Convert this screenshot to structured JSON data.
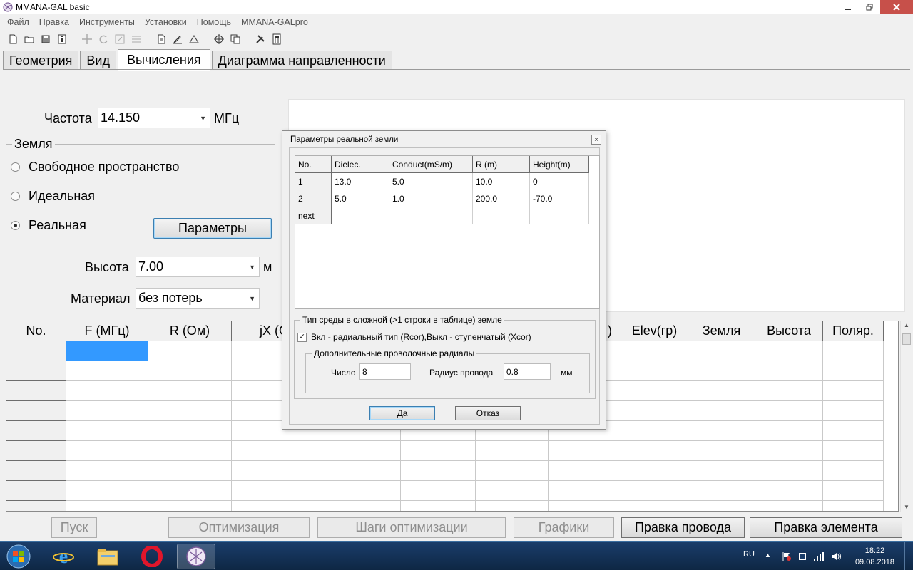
{
  "window": {
    "title": "MMANA-GAL basic"
  },
  "menu": [
    "Файл",
    "Правка",
    "Инструменты",
    "Установки",
    "Помощь",
    "MMANA-GALpro"
  ],
  "tabs": [
    "Геометрия",
    "Вид",
    "Вычисления",
    "Диаграмма направленности"
  ],
  "active_tab": "Вычисления",
  "calc": {
    "freq_label": "Частота",
    "freq_value": "14.150",
    "freq_unit": "МГц",
    "ground_legend": "Земля",
    "ground_options": [
      "Свободное пространство",
      "Идеальная",
      "Реальная"
    ],
    "ground_selected": "Реальная",
    "params_button": "Параметры",
    "height_label": "Высота",
    "height_value": "7.00",
    "height_unit": "м",
    "material_label": "Материал",
    "material_value": "без потерь"
  },
  "results_table": {
    "headers": [
      "No.",
      "F (МГц)",
      "R (Ом)",
      "jX (О",
      "",
      "",
      "",
      ")",
      "Elev(гр)",
      "Земля",
      "Высота",
      "Поляр."
    ]
  },
  "bottom_buttons": {
    "run": "Пуск",
    "optimize": "Оптимизация",
    "opt_steps": "Шаги оптимизации",
    "graphs": "Графики",
    "edit_wire": "Правка провода",
    "edit_element": "Правка элемента"
  },
  "dialog": {
    "title": "Параметры реальной земли",
    "close_glyph": "×",
    "table": {
      "headers": [
        "No.",
        "Dielec.",
        "Conduct(mS/m)",
        "R (m)",
        "Height(m)"
      ],
      "rows": [
        [
          "1",
          "13.0",
          "5.0",
          "10.0",
          "0"
        ],
        [
          "2",
          "5.0",
          "1.0",
          "200.0",
          "-70.0"
        ],
        [
          "next",
          "",
          "",
          "",
          ""
        ]
      ]
    },
    "medium_legend": "Тип среды в сложной (>1 строки в таблице) земле",
    "radial_checkbox_label": "Вкл - радиальный тип (Rcor),Выкл - ступенчатый (Xcor)",
    "radial_checked": true,
    "radials_legend": "Дополнительные проволочные радиалы",
    "count_label": "Число",
    "count_value": "8",
    "radius_label": "Радиус провода",
    "radius_value": "0.8",
    "radius_unit": "мм",
    "ok": "Да",
    "cancel": "Отказ"
  },
  "taskbar": {
    "lang": "RU",
    "time": "18:22",
    "date": "09.08.2018"
  }
}
